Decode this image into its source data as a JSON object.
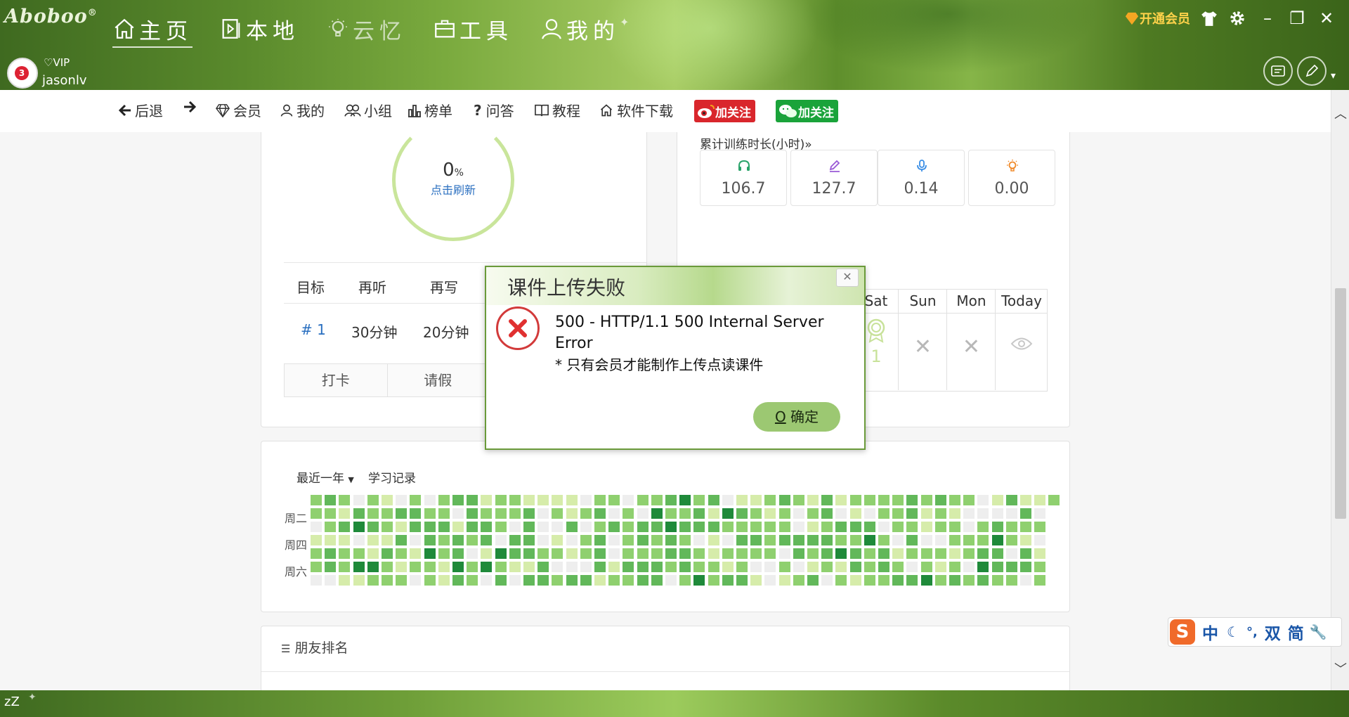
{
  "app": {
    "logo": "Aboboo",
    "logo_sup": "®",
    "user": {
      "vip_label": "VIP",
      "name": "jasonlv",
      "badge": "3"
    },
    "member_link": "开通会员"
  },
  "nav": [
    {
      "label": "主页",
      "icon": "home-icon"
    },
    {
      "label": "本地",
      "icon": "play-file-icon"
    },
    {
      "label": "云忆",
      "icon": "bulb-icon"
    },
    {
      "label": "工具",
      "icon": "toolbox-icon"
    },
    {
      "label": "我的",
      "icon": "user-icon"
    }
  ],
  "toolbar": {
    "back": "后退",
    "member": "会员",
    "mine": "我的",
    "group": "小组",
    "rank": "榜单",
    "qa": "问答",
    "tutorial": "教程",
    "download": "软件下载",
    "weibo_follow": "加关注",
    "wechat_follow": "加关注"
  },
  "progress": {
    "percent": "0",
    "unit": "%",
    "refresh": "点击刷新"
  },
  "plan": {
    "headers": [
      "目标",
      "再听",
      "再写"
    ],
    "row": [
      "# 1",
      "30分钟",
      "20分钟"
    ],
    "buttons": [
      "打卡",
      "请假"
    ]
  },
  "training": {
    "title": "累计训练时长(小时)»",
    "stats": [
      {
        "icon": "headphones-icon",
        "value": "106.7",
        "color": "#2aa36a"
      },
      {
        "icon": "pencil-icon",
        "value": "127.7",
        "color": "#9a5ad6"
      },
      {
        "icon": "mic-icon",
        "value": "0.14",
        "color": "#3a8ee6"
      },
      {
        "icon": "bulb-icon",
        "value": "0.00",
        "color": "#f08a2a"
      }
    ]
  },
  "week": {
    "days": [
      "Sat",
      "Sun",
      "Mon",
      "Today"
    ],
    "sat_count": "1"
  },
  "heatmap": {
    "range_label": "最近一年",
    "title": "学习记录",
    "day_labels": [
      "周二",
      "周四",
      "周六"
    ],
    "colors": [
      "#eeeeee",
      "#d6ecaa",
      "#8fd06f",
      "#62b85a",
      "#1f8a3a"
    ]
  },
  "friends": {
    "title": "朋友排名"
  },
  "dialog": {
    "title": "课件上传失败",
    "line1": "500 - HTTP/1.1 500 Internal Server",
    "line2": "Error",
    "line3": "* 只有会员才能制作上传点读课件",
    "ok_hotkey": "O",
    "ok_label": " 确定"
  },
  "ime": {
    "labels": [
      "中",
      "双",
      "简"
    ]
  },
  "status": {
    "sleep": "zZ"
  }
}
